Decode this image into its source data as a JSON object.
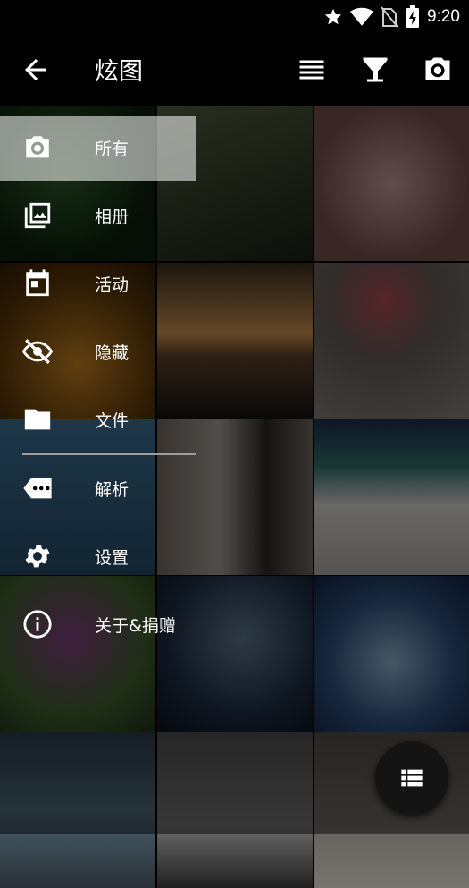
{
  "status_bar": {
    "time": "9:20"
  },
  "app_bar": {
    "title": "炫图"
  },
  "drawer": {
    "items": [
      {
        "label": "所有",
        "icon": "camera-icon",
        "selected": true
      },
      {
        "label": "相册",
        "icon": "photo-library-icon"
      },
      {
        "label": "活动",
        "icon": "calendar-icon"
      },
      {
        "label": "隐藏",
        "icon": "visibility-off-icon"
      },
      {
        "label": "文件",
        "icon": "folder-icon"
      },
      {
        "label": "解析",
        "icon": "more-dots-icon"
      },
      {
        "label": "设置",
        "icon": "gear-icon"
      },
      {
        "label": "关于&捐赠",
        "icon": "info-icon"
      }
    ]
  },
  "colors": {
    "background": "#000000",
    "selected_row": "#8a8a8a",
    "fab": "#141414"
  }
}
